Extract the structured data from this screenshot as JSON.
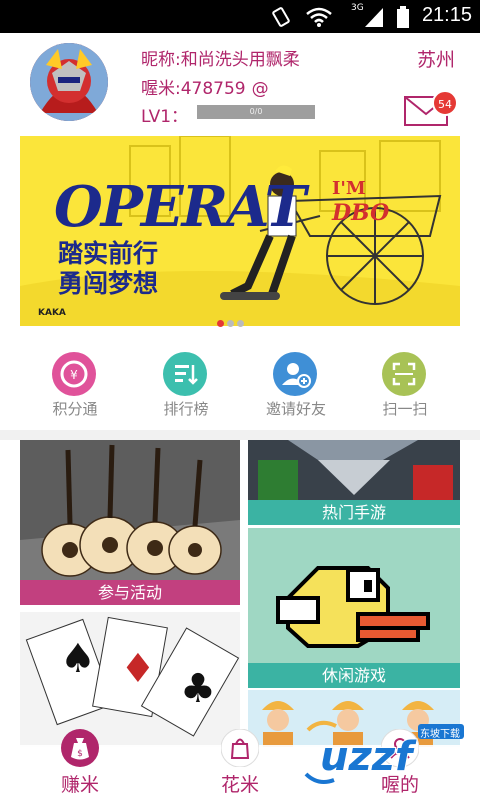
{
  "statusbar": {
    "network": "3G",
    "time": "21:15"
  },
  "profile": {
    "nickname": "昵称:和尚洗头用飘柔",
    "rice": "喔米:478759",
    "rice_symbol": "@",
    "level": "LV1：",
    "level_progress_text": "0/0",
    "level_progress": 0,
    "city": "苏州",
    "message_count": "54"
  },
  "banner": {
    "headline": "OPERAT",
    "side_text_1": "I'M",
    "side_text_2": "DBO",
    "slogan_1": "踏实前行",
    "slogan_2": "勇闯梦想",
    "brand": "KAKA",
    "slide_count": 3,
    "active_slide": 0
  },
  "quick_actions": [
    {
      "label": "积分通",
      "icon": "exchange-icon",
      "color": "#e0529a"
    },
    {
      "label": "排行榜",
      "icon": "ranking-icon",
      "color": "#3cbfae"
    },
    {
      "label": "邀请好友",
      "icon": "add-friend-icon",
      "color": "#3f8fd6"
    },
    {
      "label": "扫一扫",
      "icon": "scan-icon",
      "color": "#a8c256"
    }
  ],
  "cards": {
    "activity": "参与活动",
    "hot_games": "热门手游",
    "casual_games": "休闲游戏"
  },
  "colors": {
    "accent": "#b0266b",
    "caption_pink": "#c2407f",
    "caption_teal": "#3bb3a3"
  },
  "tabs": [
    {
      "label": "赚米",
      "icon": "money-bag-icon"
    },
    {
      "label": "花米",
      "icon": "shopping-bag-icon"
    },
    {
      "label": "喔的",
      "icon": "user-icon"
    }
  ],
  "watermark": {
    "brand": "uzzf.com",
    "cn": "东坡下载"
  }
}
